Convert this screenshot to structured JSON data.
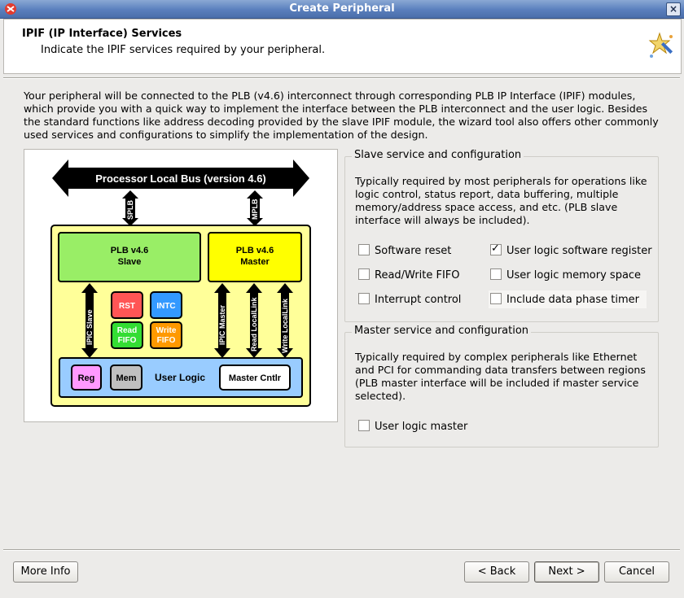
{
  "window": {
    "title": "Create Peripheral",
    "close_glyph": "×"
  },
  "header": {
    "title": "IPIF (IP Interface) Services",
    "subtitle": "Indicate the IPIF services required by your peripheral."
  },
  "intro_text": "Your peripheral will be connected to the PLB (v4.6) interconnect through corresponding PLB IP Interface (IPIF) modules, which provide you with a quick way to implement the interface between the PLB interconnect and the user logic. Besides the standard functions like address decoding provided by the slave IPIF module, the wizard tool also offers other commonly used services and configurations to simplify the implementation of the design.",
  "diagram": {
    "bus_label": "Processor Local Bus (version 4.6)",
    "splb": "SPLB",
    "mplb": "MPLB",
    "slave_block": [
      "PLB v4.6",
      "Slave"
    ],
    "master_block": [
      "PLB v4.6",
      "Master"
    ],
    "rst": "RST",
    "intc": "INTC",
    "read_fifo": [
      "Read",
      "FIFO"
    ],
    "write_fifo": [
      "Write",
      "FIFO"
    ],
    "ipic_slave": "IPIC Slave",
    "ipic_master": "IPIC Master",
    "read_locallink": "Read LocalLink",
    "write_locallink": "Write LocalLink",
    "reg": "Reg",
    "mem": "Mem",
    "user_logic": "User Logic",
    "master_cntlr": "Master Cntlr"
  },
  "slave_group": {
    "title": "Slave service and configuration",
    "description": "Typically required by most peripherals for operations like logic control, status report, data buffering, multiple memory/address space access, and etc. (PLB slave interface will always be included).",
    "options": [
      {
        "label": "Software reset",
        "checked": false
      },
      {
        "label": "User logic software register",
        "checked": true
      },
      {
        "label": "Read/Write FIFO",
        "checked": false
      },
      {
        "label": "User logic memory space",
        "checked": false
      },
      {
        "label": "Interrupt control",
        "checked": false
      },
      {
        "label": "Include data phase timer",
        "checked": false
      }
    ]
  },
  "master_group": {
    "title": "Master service and configuration",
    "description": "Typically required by complex peripherals like Ethernet and PCI for commanding data transfers between regions (PLB master interface will be included if master service selected).",
    "option": {
      "label": "User logic master",
      "checked": false
    }
  },
  "buttons": {
    "more_info": "More Info",
    "back": "< Back",
    "next": "Next >",
    "cancel": "Cancel"
  },
  "colors": {
    "titlebar": "#5a7fbd",
    "slave_block": "#99ee66",
    "master_block": "#ffff00",
    "core_bg": "#ffff99",
    "user_logic_bg": "#99ccff",
    "rst": "#ff5555",
    "intc": "#3399ff",
    "read_fifo": "#33dd33",
    "write_fifo": "#ff9900",
    "reg": "#ff99ff",
    "mem": "#c0c0c0"
  }
}
